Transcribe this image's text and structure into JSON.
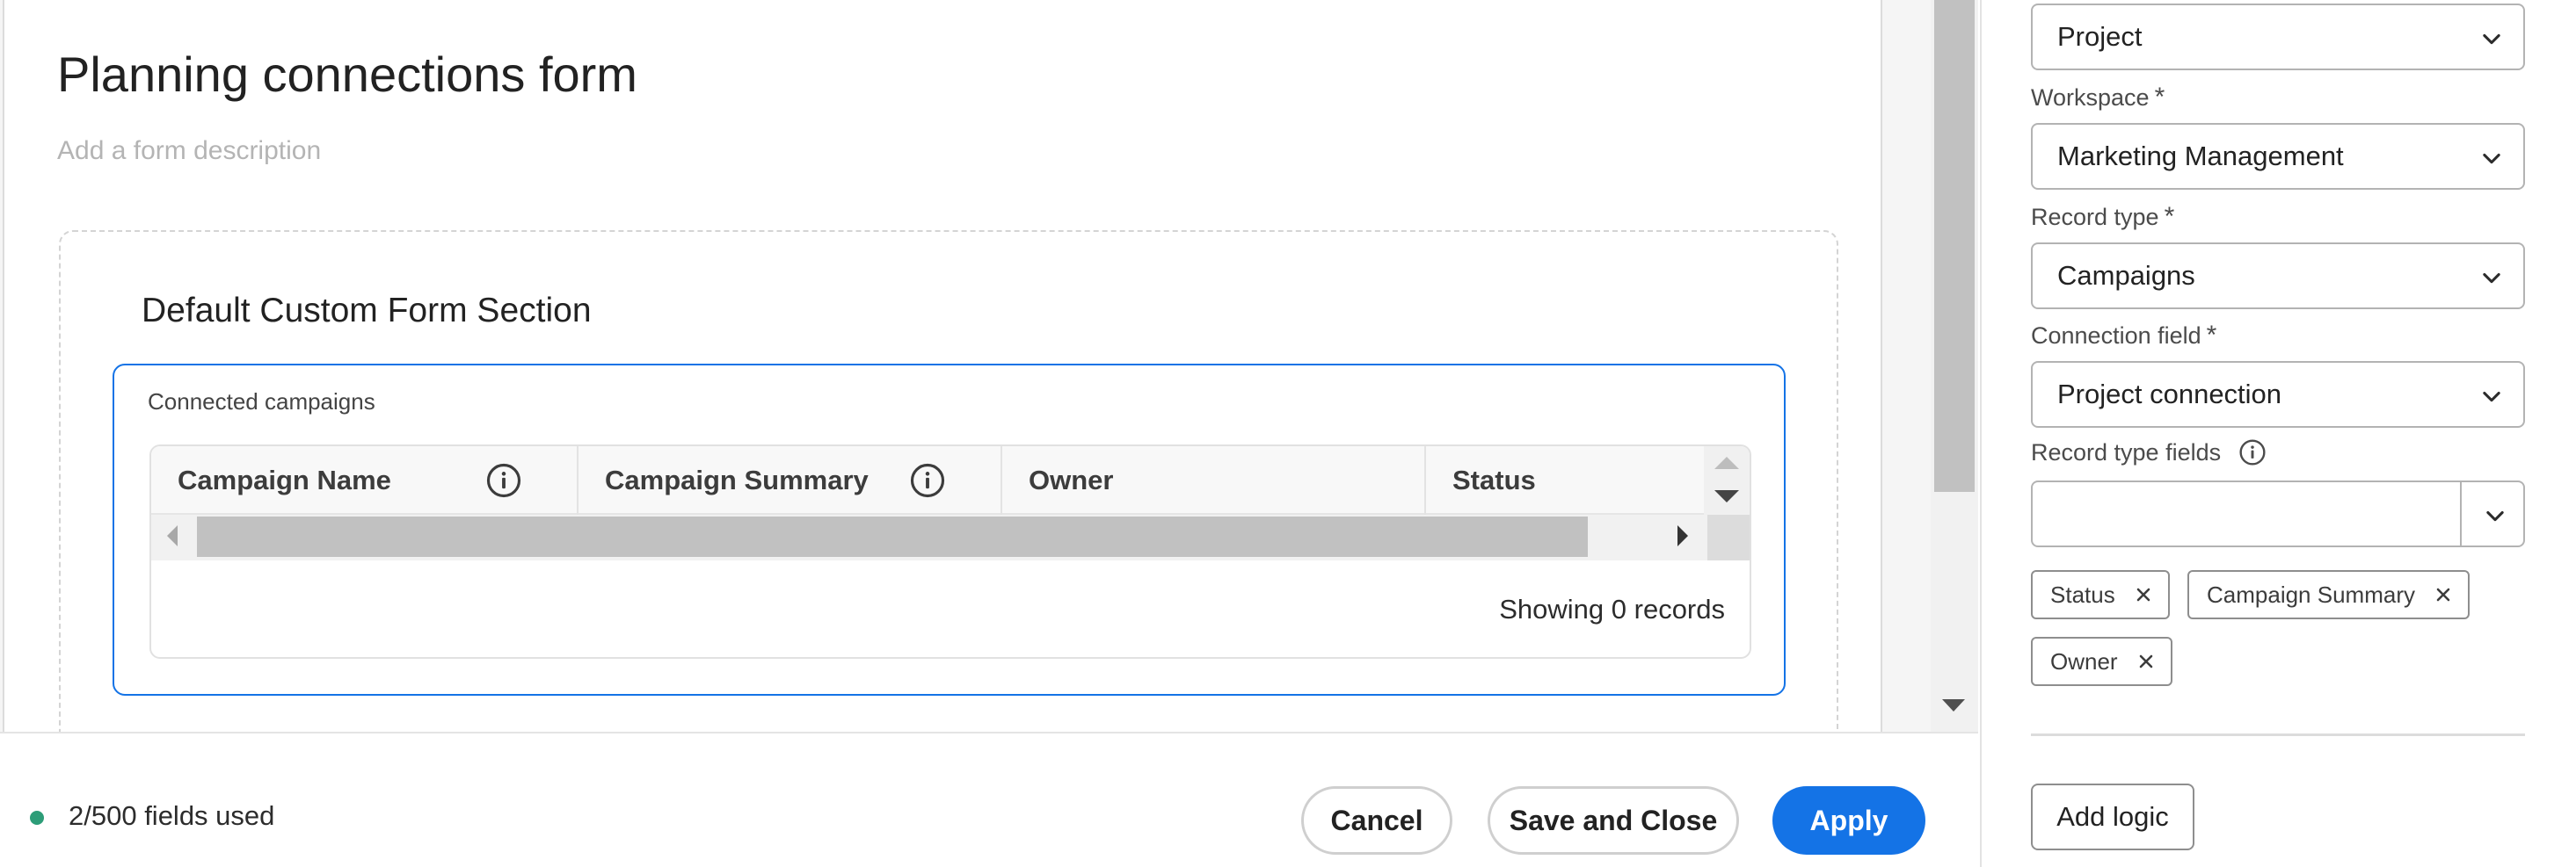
{
  "form": {
    "title": "Planning connections form",
    "description_placeholder": "Add a form description",
    "section_title": "Default Custom Form Section",
    "widget": {
      "label": "Connected campaigns",
      "columns": [
        "Campaign Name",
        "Campaign Summary",
        "Owner",
        "Status"
      ],
      "records_text": "Showing 0 records"
    }
  },
  "footer": {
    "fields_used": "2/500 fields used",
    "status_color": "#2d9d78",
    "cancel_label": "Cancel",
    "save_close_label": "Save and Close",
    "apply_label": "Apply",
    "accent_color": "#1473e6"
  },
  "panel": {
    "object_type_value": "Project",
    "workspace": {
      "label": "Workspace",
      "required_mark": "*",
      "value": "Marketing Management"
    },
    "record_type": {
      "label": "Record type",
      "required_mark": "*",
      "value": "Campaigns"
    },
    "connection_field": {
      "label": "Connection field",
      "required_mark": "*",
      "value": "Project connection"
    },
    "record_type_fields": {
      "label": "Record type fields",
      "tags": [
        "Status",
        "Campaign Summary",
        "Owner"
      ]
    },
    "add_logic_label": "Add logic"
  },
  "icons": {
    "info": "info-icon",
    "chevron": "chevron-down-icon",
    "remove": "close-icon"
  }
}
